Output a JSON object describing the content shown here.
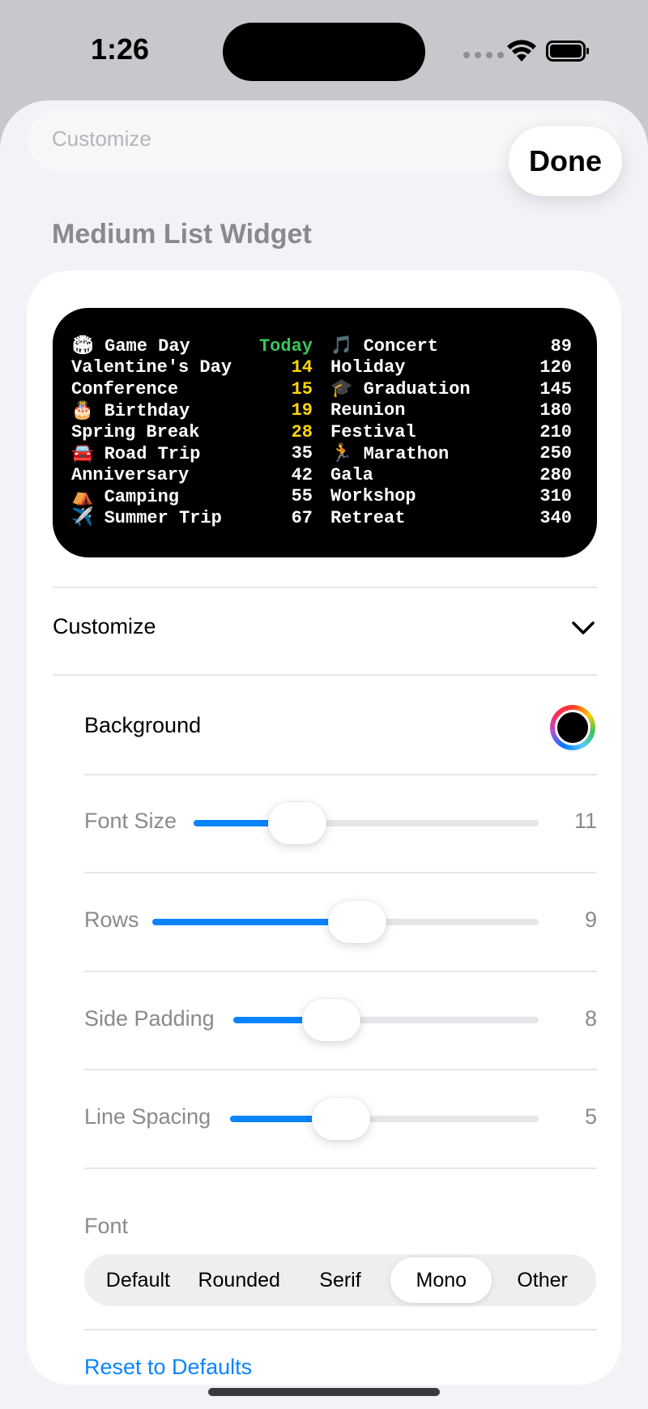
{
  "status_bar": {
    "time": "1:26"
  },
  "header": {
    "previous_row_label": "Customize",
    "done_label": "Done"
  },
  "section_title": "Medium List Widget",
  "widget_preview": {
    "left_column": [
      {
        "label": "🏟 Game Day",
        "value": "Today",
        "value_color": "#34c759"
      },
      {
        "label": "Valentine's Day",
        "value": "14",
        "value_color": "#ffd60a"
      },
      {
        "label": "Conference",
        "value": "15",
        "value_color": "#ffd60a"
      },
      {
        "label": "🎂 Birthday",
        "value": "19",
        "value_color": "#ffd60a"
      },
      {
        "label": "Spring Break",
        "value": "28",
        "value_color": "#ffd60a"
      },
      {
        "label": "🚘 Road Trip",
        "value": "35",
        "value_color": "#ffffff"
      },
      {
        "label": "Anniversary",
        "value": "42",
        "value_color": "#ffffff"
      },
      {
        "label": "⛺ Camping",
        "value": "55",
        "value_color": "#ffffff"
      },
      {
        "label": "✈️ Summer Trip",
        "value": "67",
        "value_color": "#ffffff"
      }
    ],
    "right_column": [
      {
        "label": "🎵 Concert",
        "value": "89"
      },
      {
        "label": "Holiday",
        "value": "120"
      },
      {
        "label": "🎓 Graduation",
        "value": "145"
      },
      {
        "label": "Reunion",
        "value": "180"
      },
      {
        "label": "Festival",
        "value": "210"
      },
      {
        "label": "🏃 Marathon",
        "value": "250"
      },
      {
        "label": "Gala",
        "value": "280"
      },
      {
        "label": "Workshop",
        "value": "310"
      },
      {
        "label": "Retreat",
        "value": "340"
      }
    ]
  },
  "customize": {
    "label": "Customize",
    "background_label": "Background",
    "background_color": "#000000",
    "sliders": [
      {
        "label": "Font Size",
        "value": "11",
        "fraction": 0.3
      },
      {
        "label": "Rows",
        "value": "9",
        "fraction": 0.53
      },
      {
        "label": "Side Padding",
        "value": "8",
        "fraction": 0.32
      },
      {
        "label": "Line Spacing",
        "value": "5",
        "fraction": 0.36
      }
    ],
    "font_label": "Font",
    "font_options": [
      "Default",
      "Rounded",
      "Serif",
      "Mono",
      "Other"
    ],
    "font_selected": "Mono",
    "reset_label": "Reset to Defaults"
  },
  "colors": {
    "accent": "#0a84ff",
    "today": "#34c759",
    "soon": "#ffd60a"
  }
}
